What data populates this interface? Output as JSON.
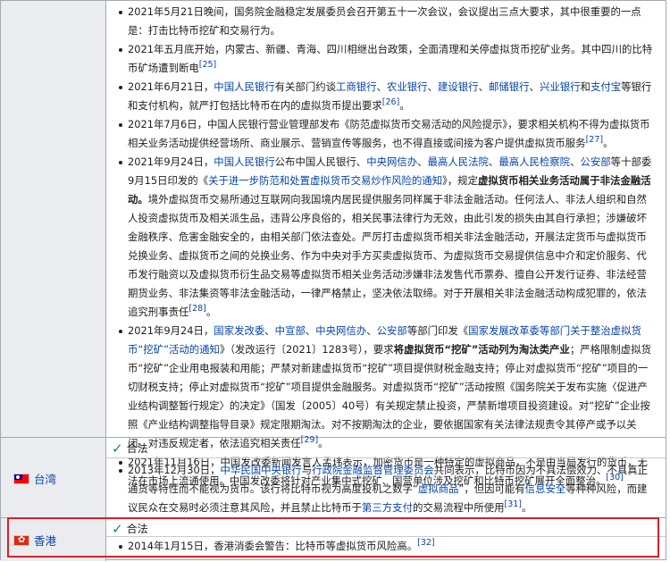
{
  "mainland": {
    "items": [
      [
        {
          "t": "2021年5月21日晚间，国务院金融稳定发展委员会召开第五十一次会议，会议提出三点大要求，其中很重要的一点是：打击比特币挖矿和交易行为。"
        }
      ],
      [
        {
          "t": "2021年五月底开始，内蒙古、新疆、青海、四川相继出台政策，全面清理和关停虚拟货币挖矿业务。其中四川的比特币矿场遭到断电"
        },
        {
          "t": "[25]",
          "s": "ref"
        }
      ],
      [
        {
          "t": "2021年6月21日，"
        },
        {
          "t": "中国人民银行",
          "s": "lk"
        },
        {
          "t": "有关部门约谈"
        },
        {
          "t": "工商银行",
          "s": "lk"
        },
        {
          "t": "、"
        },
        {
          "t": "农业银行",
          "s": "lk"
        },
        {
          "t": "、"
        },
        {
          "t": "建设银行",
          "s": "lk"
        },
        {
          "t": "、"
        },
        {
          "t": "邮储银行",
          "s": "lk"
        },
        {
          "t": "、"
        },
        {
          "t": "兴业银行",
          "s": "lk"
        },
        {
          "t": "和"
        },
        {
          "t": "支付宝",
          "s": "lk"
        },
        {
          "t": "等银行和支付机构，就严打包括比特币在内的虚拟货币提出要求"
        },
        {
          "t": "[26]",
          "s": "ref"
        },
        {
          "t": "。"
        }
      ],
      [
        {
          "t": "2021年7月6日，中国人民银行营业管理部发布《防范虚拟货币交易活动的风险提示》，要求相关机构不得为虚拟货币相关业务活动提供经营场所、商业展示、营销宣传等服务，也不得直接或间接为客户提供虚拟货币服务"
        },
        {
          "t": "[27]",
          "s": "ref"
        },
        {
          "t": "。"
        }
      ],
      [
        {
          "t": "2021年9月24日，"
        },
        {
          "t": "中国人民银行",
          "s": "lk"
        },
        {
          "t": "公布中国人民银行、"
        },
        {
          "t": "中央网信办",
          "s": "lk"
        },
        {
          "t": "、"
        },
        {
          "t": "最高人民法院",
          "s": "lk"
        },
        {
          "t": "、"
        },
        {
          "t": "最高人民检察院",
          "s": "lk"
        },
        {
          "t": "、"
        },
        {
          "t": "公安部",
          "s": "lk"
        },
        {
          "t": "等十部委9月15日印发的《"
        },
        {
          "t": "关于进一步防范和处置虚拟货币交易炒作风险的通知",
          "s": "lk"
        },
        {
          "t": "》，规定"
        },
        {
          "t": "虚拟货币相关业务活动属于非法金融活动。",
          "s": "b"
        },
        {
          "t": "境外虚拟货币交易所通过互联网向我国境内居民提供服务同样属于非法金融活动。任何法人、非法人组织和自然人投资虚拟货币及相关派生品，违背公序良俗的，相关民事法律行为无效，由此引发的损失由其自行承担；涉嫌破坏金融秩序、危害金融安全的，由相关部门依法查处。严厉打击虚拟货币相关非法金融活动，开展法定货币与虚拟货币兑换业务、虚拟货币之间的兑换业务、作为中央对手方买卖虚拟货币、为虚拟货币交易提供信息中介和定价服务、代币发行融资以及虚拟货币衍生品交易等虚拟货币相关业务活动涉嫌非法发售代币票券、擅自公开发行证券、非法经营期货业务、非法集资等非法金融活动，一律严格禁止，坚决依法取缔。对于开展相关非法金融活动构成犯罪的，依法追究刑事责任"
        },
        {
          "t": "[28]",
          "s": "ref"
        },
        {
          "t": "。"
        }
      ],
      [
        {
          "t": "2021年9月24日，"
        },
        {
          "t": "国家发改委",
          "s": "lk"
        },
        {
          "t": "、"
        },
        {
          "t": "中宣部",
          "s": "lk"
        },
        {
          "t": "、"
        },
        {
          "t": "中央网信办",
          "s": "lk"
        },
        {
          "t": "、"
        },
        {
          "t": "公安部",
          "s": "lk"
        },
        {
          "t": "等部门印发《"
        },
        {
          "t": "国家发展改革委等部门关于整治虚拟货币“挖矿”活动的通知",
          "s": "lk"
        },
        {
          "t": "》（发改运行〔2021〕1283号），要求"
        },
        {
          "t": "将虚拟货币“挖矿”活动列为淘汰类产业",
          "s": "b"
        },
        {
          "t": "；严格限制虚拟货币“挖矿”企业用电报装和用能；严禁对新建虚拟货币“挖矿”项目提供财税金融支持；停止对虚拟货币“挖矿”项目的一切财税支持；停止对虚拟货币“挖矿”项目提供金融服务。对虚拟货币“挖矿”活动按照《国务院关于发布实施〈促进产业结构调整暂行规定〉的决定》（国发〔2005〕40号）有关规定禁止投资，严禁新增项目投资建设。对“挖矿”企业按照《产业结构调整指导目录》规定限期淘汰。对不按期淘汰的企业，要依据国家有关法律法规责令其停产或予以关闭。对违反规定者，依法追究相关责任"
        },
        {
          "t": "[29]",
          "s": "ref"
        },
        {
          "t": "。"
        }
      ],
      [
        {
          "t": "2021年11月16日，中国发改委新闻发言人孟玮表示，加密货币是一种特定的虚拟商品，不是由当局发行的货币，无法在市场上流通使用。中国发改委将针对产业集中式挖矿、国营单位涉及挖矿和比特币挖矿展开全面整治。"
        },
        {
          "t": "[30]",
          "s": "ref"
        }
      ]
    ]
  },
  "taiwan": {
    "region": "台湾",
    "status": "合法",
    "items": [
      [
        {
          "t": "2013年12月30日，"
        },
        {
          "t": "中华民国中央银行",
          "s": "lk"
        },
        {
          "t": "与"
        },
        {
          "t": "行政院金融监督管理委员会",
          "s": "lk"
        },
        {
          "t": "共同表示，比特币因为不具法偿效力、不具真正通货等特性而不能视为货币。该行将比特币视为高度投机之数字“"
        },
        {
          "t": "虚拟商品",
          "s": "lk"
        },
        {
          "t": "”，但因可能有"
        },
        {
          "t": "信息安全",
          "s": "lk"
        },
        {
          "t": "等种种风险，而建议民众在交易时必须注意其风险，并且禁止比特币于"
        },
        {
          "t": "第三方支付",
          "s": "lk"
        },
        {
          "t": "的交易流程中所使用"
        },
        {
          "t": "[31]",
          "s": "ref"
        },
        {
          "t": "。"
        }
      ]
    ]
  },
  "hongkong": {
    "region": "香港",
    "status": "合法",
    "items": [
      [
        {
          "t": "2014年1月15日，香港消委会警告：比特币等虚拟货币风险高。"
        },
        {
          "t": "[32]",
          "s": "ref"
        }
      ]
    ]
  },
  "colors": {
    "link": "#0645ad",
    "check": "#14866d",
    "highlight": "#d62128",
    "header_bg": "#eaecf0",
    "border": "#a2a9b1"
  }
}
